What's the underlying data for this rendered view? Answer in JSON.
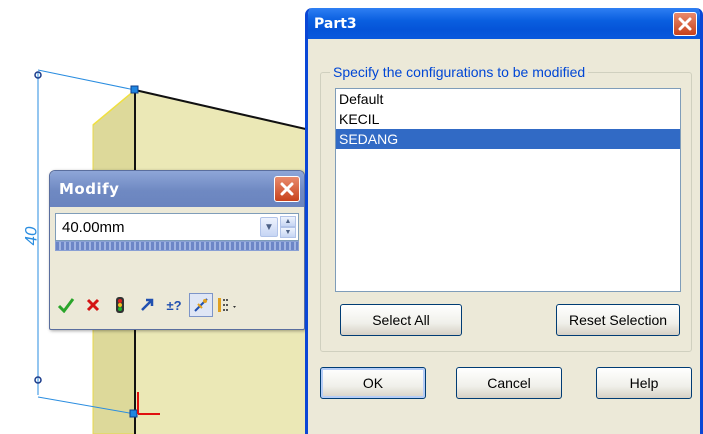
{
  "modify_dialog": {
    "title": "Modify",
    "value": "40.00mm",
    "toolbar_icons": [
      "ok-checkmark-icon",
      "cancel-x-icon",
      "rebuild-traffic-light-icon",
      "reverse-sense-icon",
      "tolerance-icon",
      "mark-dimension-icon",
      "configurations-icon"
    ]
  },
  "dimension_label": "40",
  "part_dialog": {
    "title": "Part3",
    "group_label": "Specify the configurations to be modified",
    "configurations": [
      "Default",
      "KECIL",
      "SEDANG"
    ],
    "selected_configuration": "SEDANG",
    "select_all_label": "Select All",
    "reset_selection_label": "Reset Selection",
    "ok_label": "OK",
    "cancel_label": "Cancel",
    "help_label": "Help"
  },
  "colors": {
    "part_face": "#ebe8b6",
    "part_side": "#ddd99a",
    "dimension_line": "#2a8de0",
    "xp_titlebar": "#0a5fe0",
    "selection": "#316ac5"
  }
}
